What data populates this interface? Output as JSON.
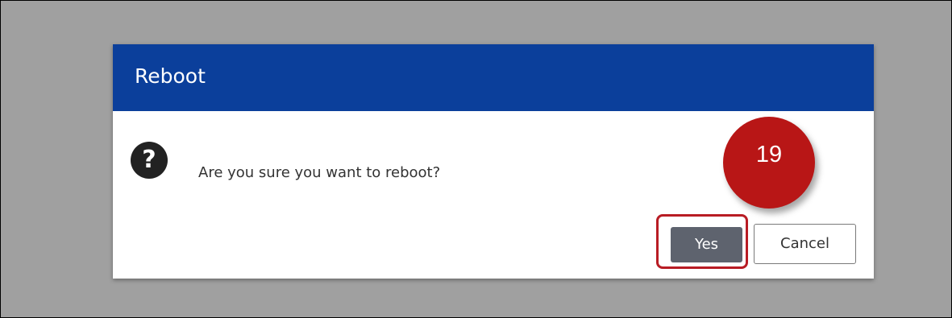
{
  "dialog": {
    "title": "Reboot",
    "message": "Are you sure you want to reboot?",
    "icon": "question-icon",
    "header_color": "#0b3f9b"
  },
  "buttons": {
    "yes_label": "Yes",
    "cancel_label": "Cancel"
  },
  "annotation": {
    "step_number": "19",
    "badge_color": "#b81616",
    "highlight_color": "#b81c24"
  }
}
